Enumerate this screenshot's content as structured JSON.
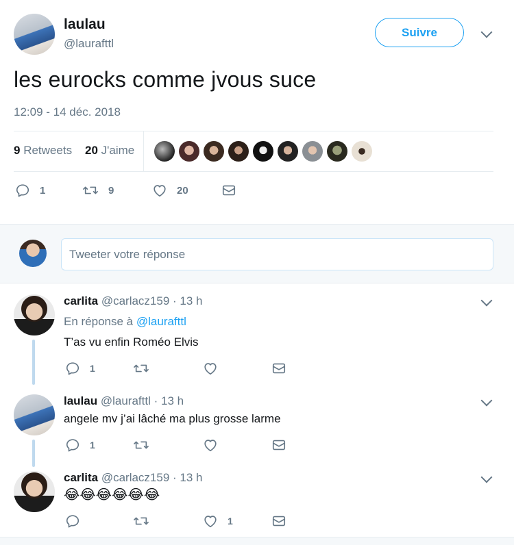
{
  "tweet": {
    "author_name": "laulau",
    "author_handle": "@laurafttl",
    "follow_label": "Suivre",
    "text": "les eurocks comme jvous suce",
    "timestamp": "12:09 - 14 déc. 2018",
    "retweets_count": "9",
    "retweets_label": "Retweets",
    "likes_count": "20",
    "likes_label": "J'aime",
    "reply_count": "1",
    "retweet_action_count": "9",
    "like_action_count": "20"
  },
  "reply_box": {
    "placeholder": "Tweeter votre réponse"
  },
  "replies": [
    {
      "name": "carlita",
      "handle": "@carlacz159",
      "time": "· 13 h",
      "in_reply_prefix": "En réponse à",
      "in_reply_handle": "@laurafttl",
      "text": "T’as vu enfin Roméo Elvis",
      "reply_count": "1",
      "like_count": ""
    },
    {
      "name": "laulau",
      "handle": "@laurafttl",
      "time": "· 13 h",
      "text": "angele mv j’ai lâché ma plus grosse larme",
      "reply_count": "1",
      "like_count": ""
    },
    {
      "name": "carlita",
      "handle": "@carlacz159",
      "time": "· 13 h",
      "text": "😂😂😂😂😂😂",
      "reply_count": "",
      "like_count": "1"
    }
  ],
  "colors": {
    "accent": "#1da1f2",
    "muted": "#657786",
    "text": "#14171a",
    "thread_line": "#bfd9ee"
  }
}
